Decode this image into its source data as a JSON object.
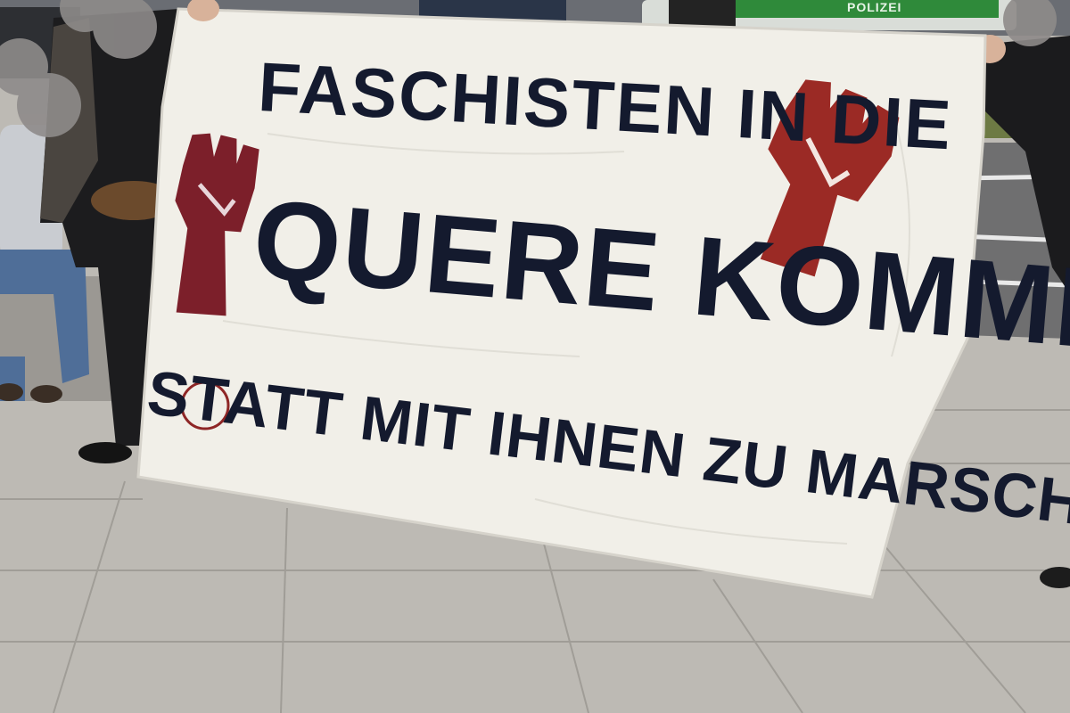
{
  "banner": {
    "line1": "FASCHISTEN IN DIE",
    "line2": "QUERE KOMMEN",
    "line3": "STATT MIT IHNEN ZU MARSCHIEREN"
  },
  "background": {
    "vehicle_text": "POLIZEI"
  },
  "icons": {
    "left": "raised-fist-icon",
    "right": "raised-fist-icon"
  },
  "colors": {
    "banner": "#f1efe8",
    "ink": "#141a2e",
    "fist": "#8e2626",
    "pavement": "#b9b6b0",
    "police_green": "#2f8a3a"
  }
}
